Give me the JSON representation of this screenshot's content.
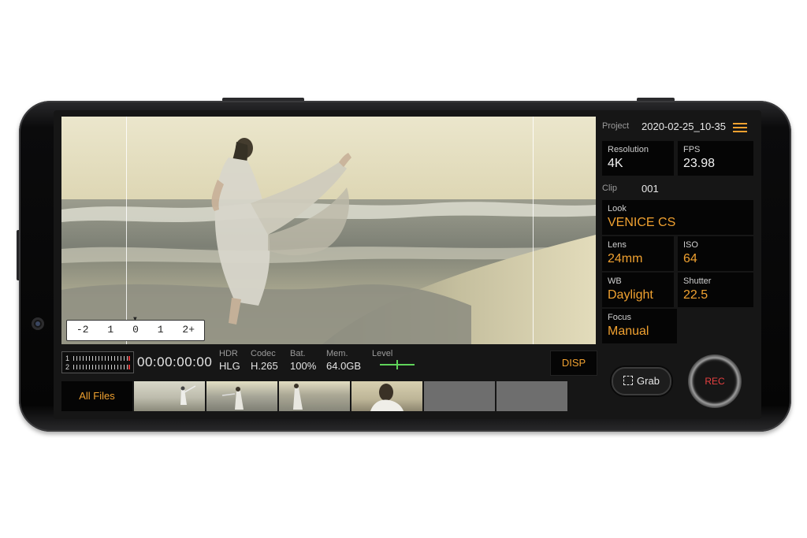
{
  "viewfinder": {
    "exposure_scale": [
      "-2",
      "1",
      "0",
      "1",
      "2+"
    ]
  },
  "status": {
    "audio_ch1": "1",
    "audio_ch2": "2",
    "timecode": "00:00:00:00",
    "hdr_label": "HDR",
    "hdr_value": "HLG",
    "codec_label": "Codec",
    "codec_value": "H.265",
    "battery_label": "Bat.",
    "battery_value": "100%",
    "memory_label": "Mem.",
    "memory_value": "64.0GB",
    "level_label": "Level",
    "disp_label": "DISP"
  },
  "files": {
    "all_files_label": "All Files"
  },
  "panel": {
    "project_label": "Project",
    "project_value": "2020-02-25_10-35",
    "resolution_label": "Resolution",
    "resolution_value": "4K",
    "fps_label": "FPS",
    "fps_value": "23.98",
    "clip_label": "Clip",
    "clip_value": "001",
    "look_label": "Look",
    "look_value": "VENICE CS",
    "lens_label": "Lens",
    "lens_value": "24mm",
    "iso_label": "ISO",
    "iso_value": "64",
    "wb_label": "WB",
    "wb_value": "Daylight",
    "shutter_label": "Shutter",
    "shutter_value": "22.5",
    "focus_label": "Focus",
    "focus_value": "Manual",
    "grab_label": "Grab",
    "rec_label": "REC"
  },
  "colors": {
    "accent": "#f0a130",
    "rec": "#e64040",
    "level": "#5fd35a"
  }
}
